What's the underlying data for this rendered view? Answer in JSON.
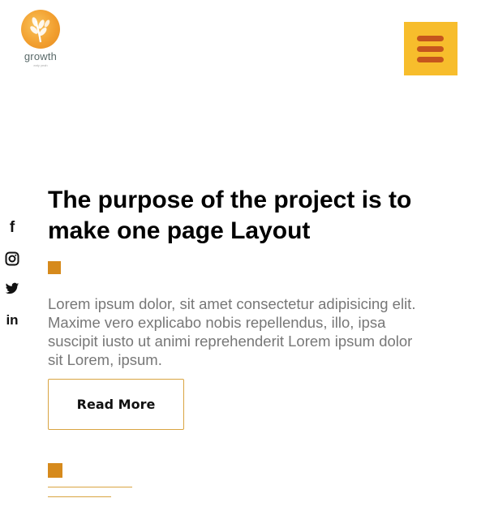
{
  "logo": {
    "name": "growth",
    "tagline": "eaty yeah"
  },
  "header": {
    "menu_icon": "hamburger-icon",
    "accent": "#f7bd2c",
    "bar_color": "#c5551d"
  },
  "social": {
    "icons": [
      "facebook-icon",
      "instagram-icon",
      "twitter-icon",
      "linkedin-icon"
    ],
    "facebook": "f",
    "linkedin": "in"
  },
  "hero": {
    "headline": "The purpose of the project is to make one page Layout",
    "body": "Lorem ipsum dolor, sit amet consectetur adipisicing elit. Maxime vero explicabo nobis repellendus, illo, ipsa suscipit iusto ut animi reprehenderit Lorem ipsum dolor sit Lorem, ipsum.",
    "button_label": "Read More",
    "accent": "#d68a1c"
  }
}
